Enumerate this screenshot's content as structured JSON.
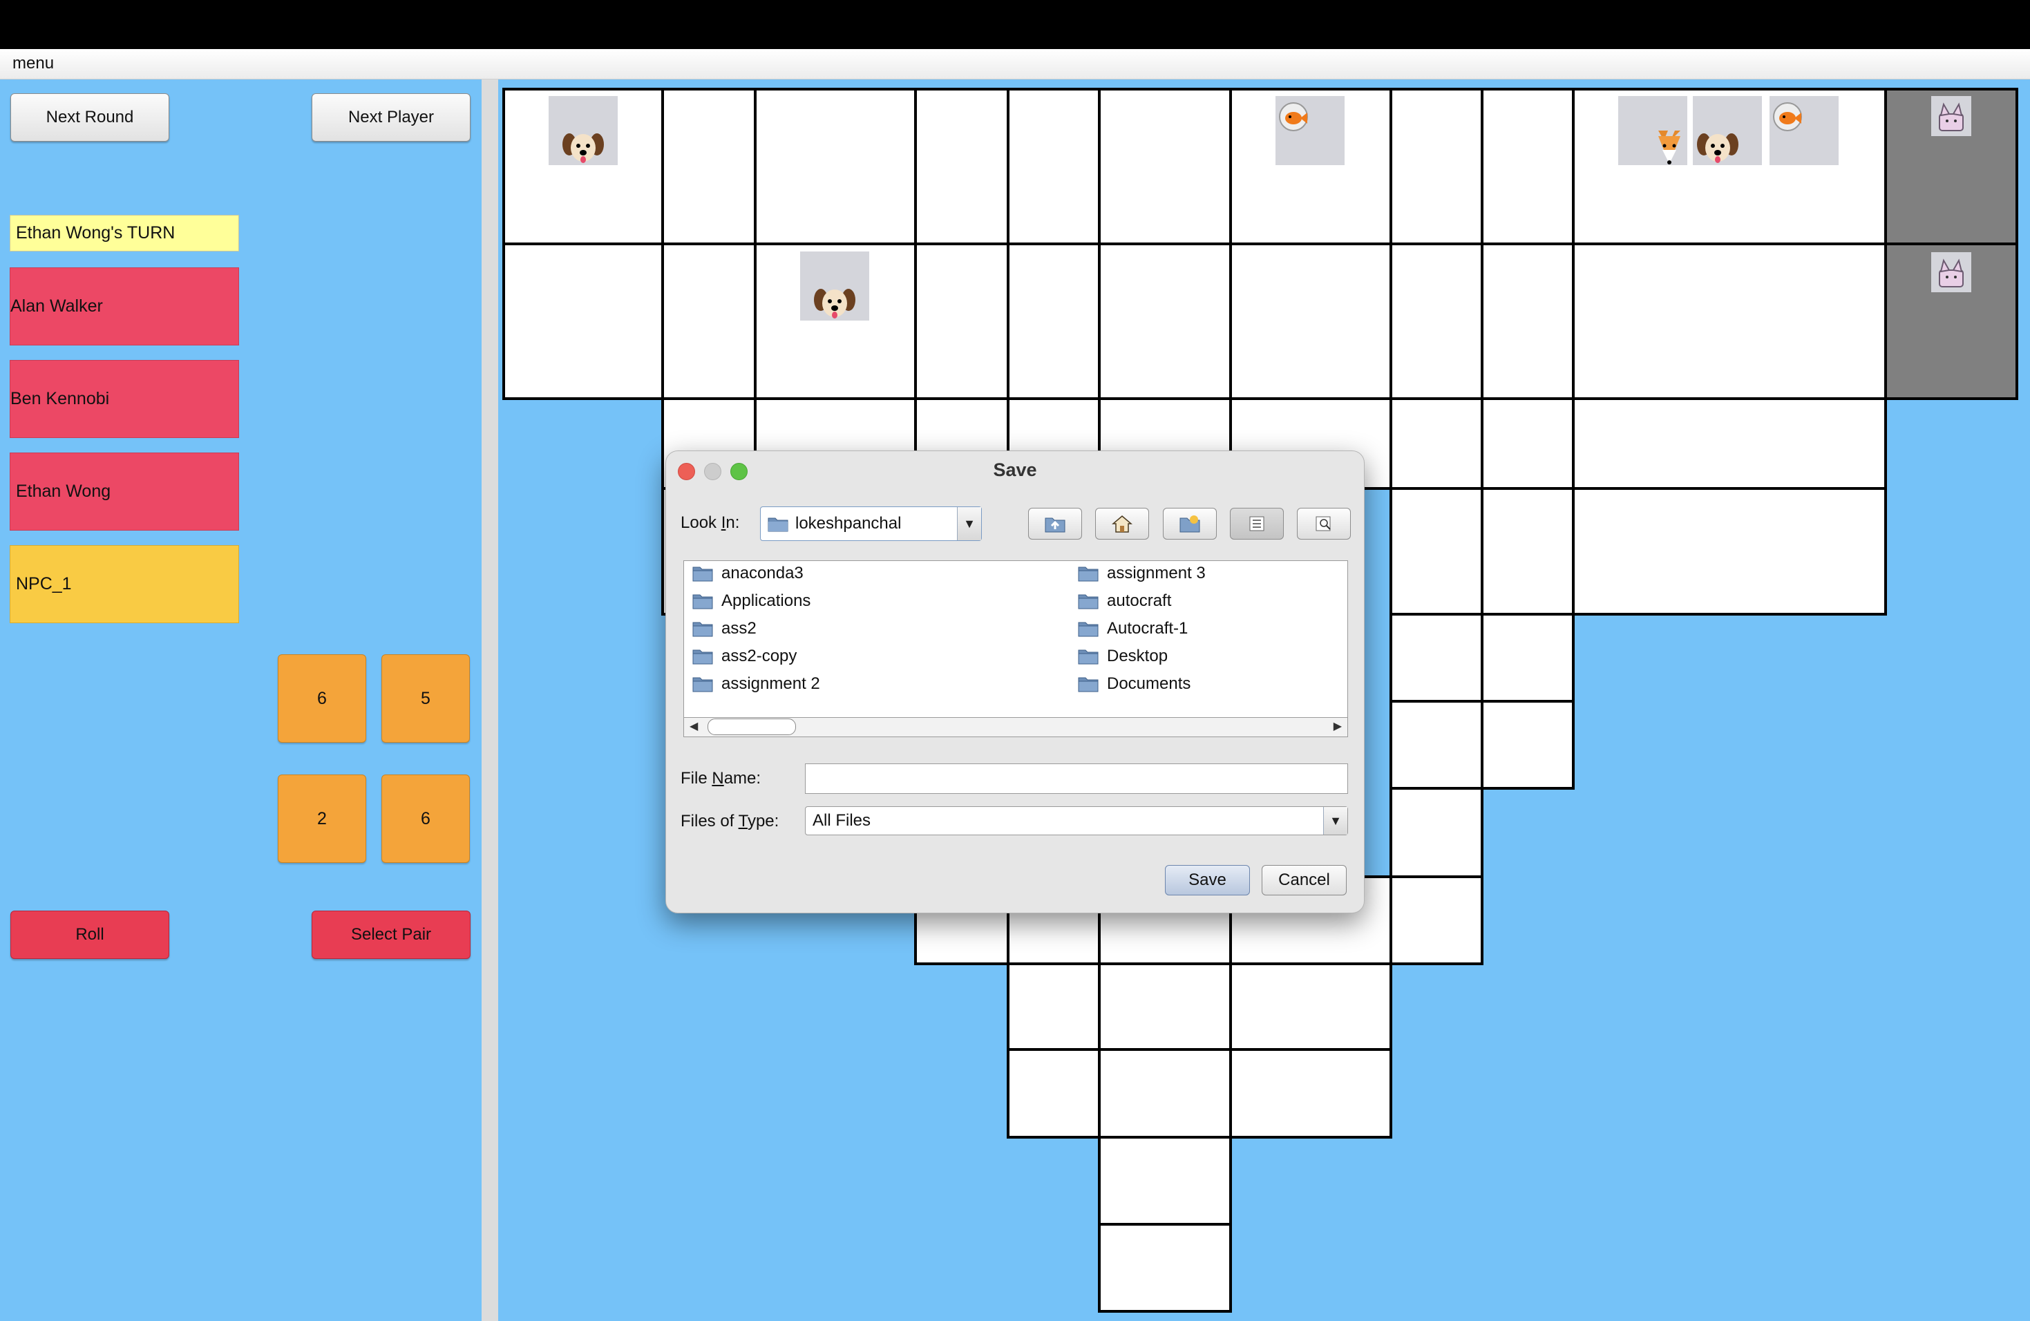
{
  "menubar": {
    "menu_label": "menu"
  },
  "controls": {
    "next_round": "Next Round",
    "next_player": "Next Player",
    "roll": "Roll",
    "select_pair": "Select Pair"
  },
  "turn": {
    "text": "Ethan Wong's TURN",
    "color": "#ffff99"
  },
  "players": [
    {
      "name": "Alan Walker",
      "color": "#ec4865"
    },
    {
      "name": "Ben Kennobi",
      "color": "#ec4865"
    },
    {
      "name": "Ethan Wong",
      "color": "#ec4865"
    },
    {
      "name": "NPC_1",
      "color": "#f9cb44"
    }
  ],
  "dice": [
    "6",
    "5",
    "2",
    "6"
  ],
  "board": {
    "tokens": [
      {
        "icon": "dog-token-icon"
      },
      {
        "icon": "fox-token-icon"
      },
      {
        "icon": "dog-token-icon"
      },
      {
        "icon": "fish-token-icon"
      },
      {
        "icon": "dog-token-icon"
      },
      {
        "icon": "fish-token-icon"
      },
      {
        "icon": "cat-token-icon"
      },
      {
        "icon": "cat-token-icon"
      }
    ]
  },
  "dialog": {
    "title": "Save",
    "look_in_label": "Look In:",
    "look_in_value": "lokeshpanchal",
    "toolbar_icons": [
      "up-folder-icon",
      "home-icon",
      "new-folder-icon",
      "list-view-icon",
      "details-view-icon"
    ],
    "files": [
      "anaconda3",
      "Applications",
      "ass2",
      "ass2-copy",
      "assignment 2",
      "assignment 3",
      "autocraft",
      "Autocraft-1",
      "Desktop",
      "Documents"
    ],
    "file_name_label": "File Name:",
    "file_name_value": "",
    "files_of_type_label": "Files of Type:",
    "files_of_type_value": "All Files",
    "save_button": "Save",
    "cancel_button": "Cancel"
  }
}
